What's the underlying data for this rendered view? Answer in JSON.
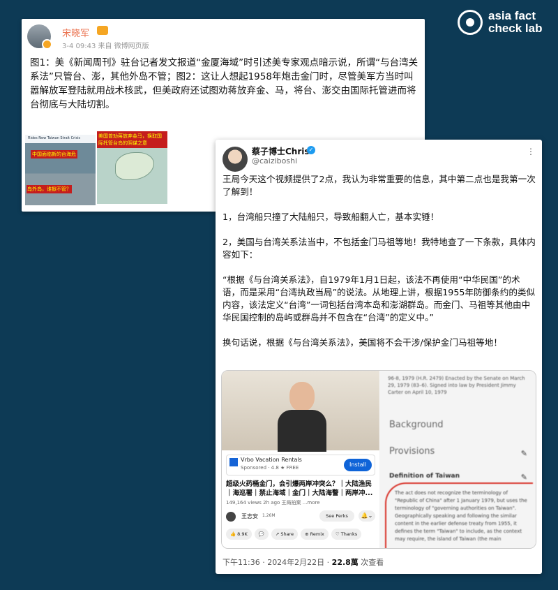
{
  "brand": {
    "line1": "asia fact",
    "line2": "check lab"
  },
  "weibo": {
    "author": "宋晓军",
    "meta": "3-4 09:43 来自 微博网页版",
    "text": "图1：美《新闻周刊》驻台记者发文报道“金厦海域”时引述美专家观点暗示说，所谓“与台湾关系法”只管台、澎，其他外岛不管；图2：这让人想起1958年炮击金门时，尽管美军方当时叫嚣解放军登陆就用战术核武，但美政府还试图劝蒋放弃金、马，将台、澎交由国际托管进而将台彻底与大陆切割。",
    "img1_header": "Rides New Taiwan Strait Crisis",
    "img1_banner": "中国面临新的台海危",
    "img1_sub": "岛外岛，谁掀不管？",
    "img2_banner": "美国曾劝蒋放弃金马，换取国际托管台岛的阴谋之意"
  },
  "tweet": {
    "name": "蔡子博士Chris",
    "handle": "@caiziboshi",
    "p1": "王局今天这个视频提供了2点，我认为非常重要的信息，其中第二点也是我第一次了解到！",
    "p2": "1，台湾船只撞了大陆船只，导致船翻人亡，基本实锤！",
    "p3": "2，美国与台湾关系法当中，不包括金门马祖等地！我特地查了一下条款，具体内容如下：",
    "quote": "“根据《与台湾关系法》，自1979年1月1日起，该法不再使用“中华民国”的术语，而是采用“台湾执政当局”的说法。从地理上讲，根据1955年防御条约的类似内容，该法定义“台湾”一词包括台湾本岛和澎湖群岛。而金门、马祖等其他由中华民国控制的岛屿或群岛并不包含在“台湾”的定义中。”",
    "p4": "换句话说，根据《与台湾关系法》，美国将不会干涉/保护金门马祖等地！",
    "footer_time": "下午11:36 · 2024年2月22日 · ",
    "footer_views": "22.8萬",
    "footer_views_label": " 次查看"
  },
  "youtube": {
    "ad_name": "Vrbo Vacation Rentals",
    "ad_sponsored": "Sponsored · 4.8 ★  FREE",
    "install": "Install",
    "title": "超级火药桶金门，会引爆两岸冲突么？｜大陆渔民｜海巡署｜禁止海域｜金门｜大陆海警｜两岸冲...",
    "stats": "149,164 views  2h ago  王局拍案  ...more",
    "channel": "王志安",
    "subs": "1.26M",
    "perks": "See Perks",
    "bell": "🔔⌄",
    "actions": [
      "👍 8.9K",
      "💬",
      "↗ Share",
      "⊕ Remix",
      "♡ Thanks"
    ]
  },
  "law": {
    "head": "96-8, 1979 (H.R. 2479) Enacted by the Senate on March 29, 1979 (83–6). Signed into law by President Jimmy Carter on April 10, 1979",
    "background": "Background",
    "provisions": "Provisions",
    "definition": "Definition of Taiwan",
    "deftext": "The act does not recognize the terminology of \"Republic of China\" after 1 January 1979, but uses the terminology of \"governing authorities on Taiwan\". Geographically speaking and following the similar content in the earlier defense treaty from 1955, it defines the term \"Taiwan\" to include, as the context may require, the island of Taiwan (the main"
  }
}
